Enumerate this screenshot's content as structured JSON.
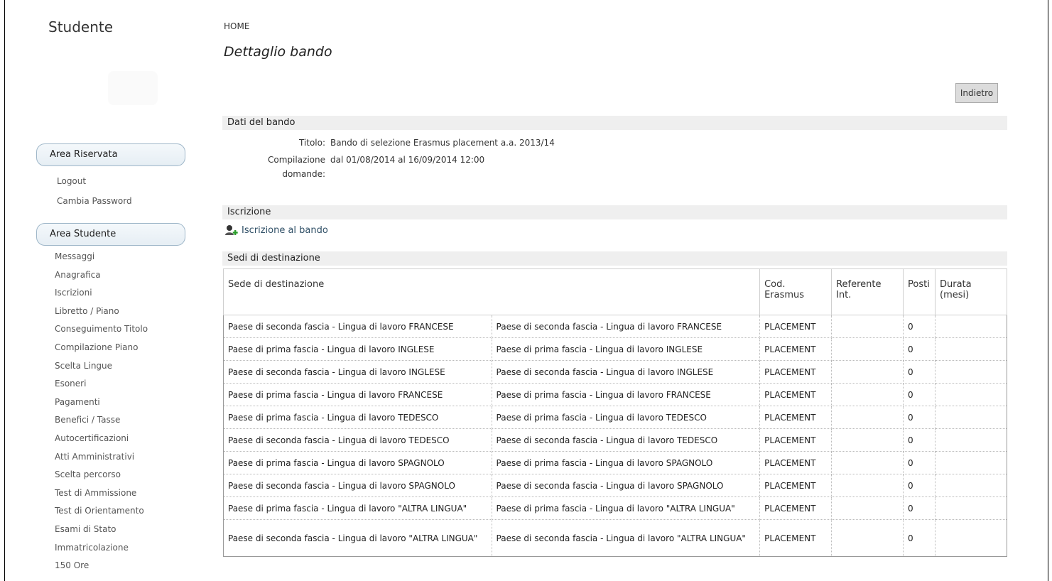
{
  "sidebar": {
    "site_title": "Studente",
    "area_riservata": {
      "title": "Area Riservata",
      "links": [
        "Logout",
        "Cambia Password"
      ]
    },
    "area_studente": {
      "title": "Area Studente",
      "links": [
        "Messaggi",
        "Anagrafica",
        "Iscrizioni",
        "Libretto / Piano",
        "Conseguimento Titolo",
        "Compilazione Piano",
        "Scelta Lingue",
        "Esoneri",
        "Pagamenti",
        "Benefici / Tasse",
        "Autocertificazioni",
        "Atti Amministrativi",
        "Scelta percorso",
        "Test di Ammissione",
        "Test di Orientamento",
        "Esami di Stato",
        "Immatricolazione",
        "150 Ore"
      ]
    }
  },
  "main": {
    "breadcrumb": "HOME",
    "page_title": "Dettaglio bando",
    "back_label": "Indietro",
    "dati_bando": {
      "heading": "Dati del bando",
      "titolo_label": "Titolo:",
      "titolo_value": "Bando di selezione Erasmus placement a.a. 2013/14",
      "compilazione_label_1": "Compilazione",
      "compilazione_label_2": "domande:",
      "compilazione_value": "dal 01/08/2014 al 16/09/2014 12:00"
    },
    "iscrizione": {
      "heading": "Iscrizione",
      "link_label": "Iscrizione al bando",
      "icon": "add-user-icon"
    },
    "sedi": {
      "heading": "Sedi di destinazione",
      "columns": [
        "Sede di destinazione",
        "Cod. Erasmus",
        "Referente Int.",
        "Posti",
        "Durata (mesi)"
      ],
      "rows": [
        {
          "sede_a": "Paese di seconda fascia - Lingua di lavoro FRANCESE",
          "sede_b": "Paese di seconda fascia - Lingua di lavoro FRANCESE",
          "cod": "PLACEMENT",
          "referente": "",
          "posti": "0",
          "durata": ""
        },
        {
          "sede_a": "Paese di prima fascia - Lingua di lavoro INGLESE",
          "sede_b": "Paese di prima fascia - Lingua di lavoro INGLESE",
          "cod": "PLACEMENT",
          "referente": "",
          "posti": "0",
          "durata": ""
        },
        {
          "sede_a": "Paese di seconda fascia - Lingua di lavoro INGLESE",
          "sede_b": "Paese di seconda fascia - Lingua di lavoro INGLESE",
          "cod": "PLACEMENT",
          "referente": "",
          "posti": "0",
          "durata": ""
        },
        {
          "sede_a": "Paese di prima fascia - Lingua di lavoro FRANCESE",
          "sede_b": "Paese di prima fascia - Lingua di lavoro FRANCESE",
          "cod": "PLACEMENT",
          "referente": "",
          "posti": "0",
          "durata": ""
        },
        {
          "sede_a": "Paese di prima fascia - Lingua di lavoro TEDESCO",
          "sede_b": "Paese di prima fascia - Lingua di lavoro TEDESCO",
          "cod": "PLACEMENT",
          "referente": "",
          "posti": "0",
          "durata": ""
        },
        {
          "sede_a": "Paese di seconda fascia - Lingua di lavoro TEDESCO",
          "sede_b": "Paese di seconda fascia - Lingua di lavoro TEDESCO",
          "cod": "PLACEMENT",
          "referente": "",
          "posti": "0",
          "durata": ""
        },
        {
          "sede_a": "Paese di prima fascia - Lingua di lavoro SPAGNOLO",
          "sede_b": "Paese di prima fascia - Lingua di lavoro SPAGNOLO",
          "cod": "PLACEMENT",
          "referente": "",
          "posti": "0",
          "durata": ""
        },
        {
          "sede_a": "Paese di seconda fascia - Lingua di lavoro SPAGNOLO",
          "sede_b": "Paese di seconda fascia - Lingua di lavoro SPAGNOLO",
          "cod": "PLACEMENT",
          "referente": "",
          "posti": "0",
          "durata": ""
        },
        {
          "sede_a": "Paese di prima fascia - Lingua di lavoro \"ALTRA LINGUA\"",
          "sede_b": "Paese di prima fascia - Lingua di lavoro \"ALTRA LINGUA\"",
          "cod": "PLACEMENT",
          "referente": "",
          "posti": "0",
          "durata": ""
        },
        {
          "sede_a": "Paese di seconda fascia - Lingua di lavoro \"ALTRA LINGUA\"",
          "sede_b": "Paese di seconda fascia - Lingua di lavoro \"ALTRA LINGUA\"",
          "cod": "PLACEMENT",
          "referente": "",
          "posti": "0",
          "durata": ""
        }
      ]
    }
  }
}
